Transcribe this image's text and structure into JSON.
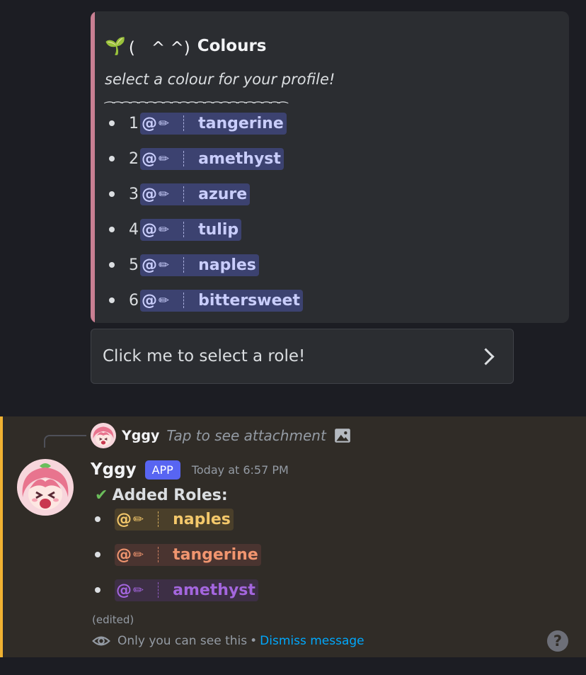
{
  "embed": {
    "title_emoji": "🌱",
    "title_face": "(　^ ^)",
    "title": "Colours",
    "subtitle": "select a colour for your profile!",
    "divider": "⁀⁀⁀⁀⁀⁀⁀⁀⁀⁀⁀⁀⁀⁀⁀⁀⁀⁀⁀⁀⁀⁀",
    "roles": [
      {
        "number": "1",
        "at": "@",
        "pencil": "✏",
        "name": "tangerine"
      },
      {
        "number": "2",
        "at": "@",
        "pencil": "✏",
        "name": "amethyst"
      },
      {
        "number": "3",
        "at": "@",
        "pencil": "✏",
        "name": "azure"
      },
      {
        "number": "4",
        "at": "@",
        "pencil": "✏",
        "name": "tulip"
      },
      {
        "number": "5",
        "at": "@",
        "pencil": "✏",
        "name": "naples"
      },
      {
        "number": "6",
        "at": "@",
        "pencil": "✏",
        "name": "bittersweet"
      }
    ],
    "accent_color": "#c87f92"
  },
  "select_menu": {
    "placeholder": "Click me to select a role!",
    "icon": "chevron-right-icon"
  },
  "message": {
    "reply": {
      "author": "Yggy",
      "text": "Tap to see attachment",
      "icon": "image-icon"
    },
    "author": "Yggy",
    "badge": "APP",
    "timestamp": "Today at 6:57 PM",
    "check": "✔",
    "heading": "Added Roles:",
    "added_roles": [
      {
        "at": "@",
        "pencil": "✏",
        "name": "naples",
        "color": "#f4c86b"
      },
      {
        "at": "@",
        "pencil": "✏",
        "name": "tangerine",
        "color": "#f0956f"
      },
      {
        "at": "@",
        "pencil": "✏",
        "name": "amethyst",
        "color": "#a466de"
      }
    ],
    "edited": "(edited)",
    "ephemeral_text": "Only you can see this",
    "separator": "•",
    "dismiss": "Dismiss message",
    "help": "?",
    "highlight_color": "#f0b232"
  }
}
